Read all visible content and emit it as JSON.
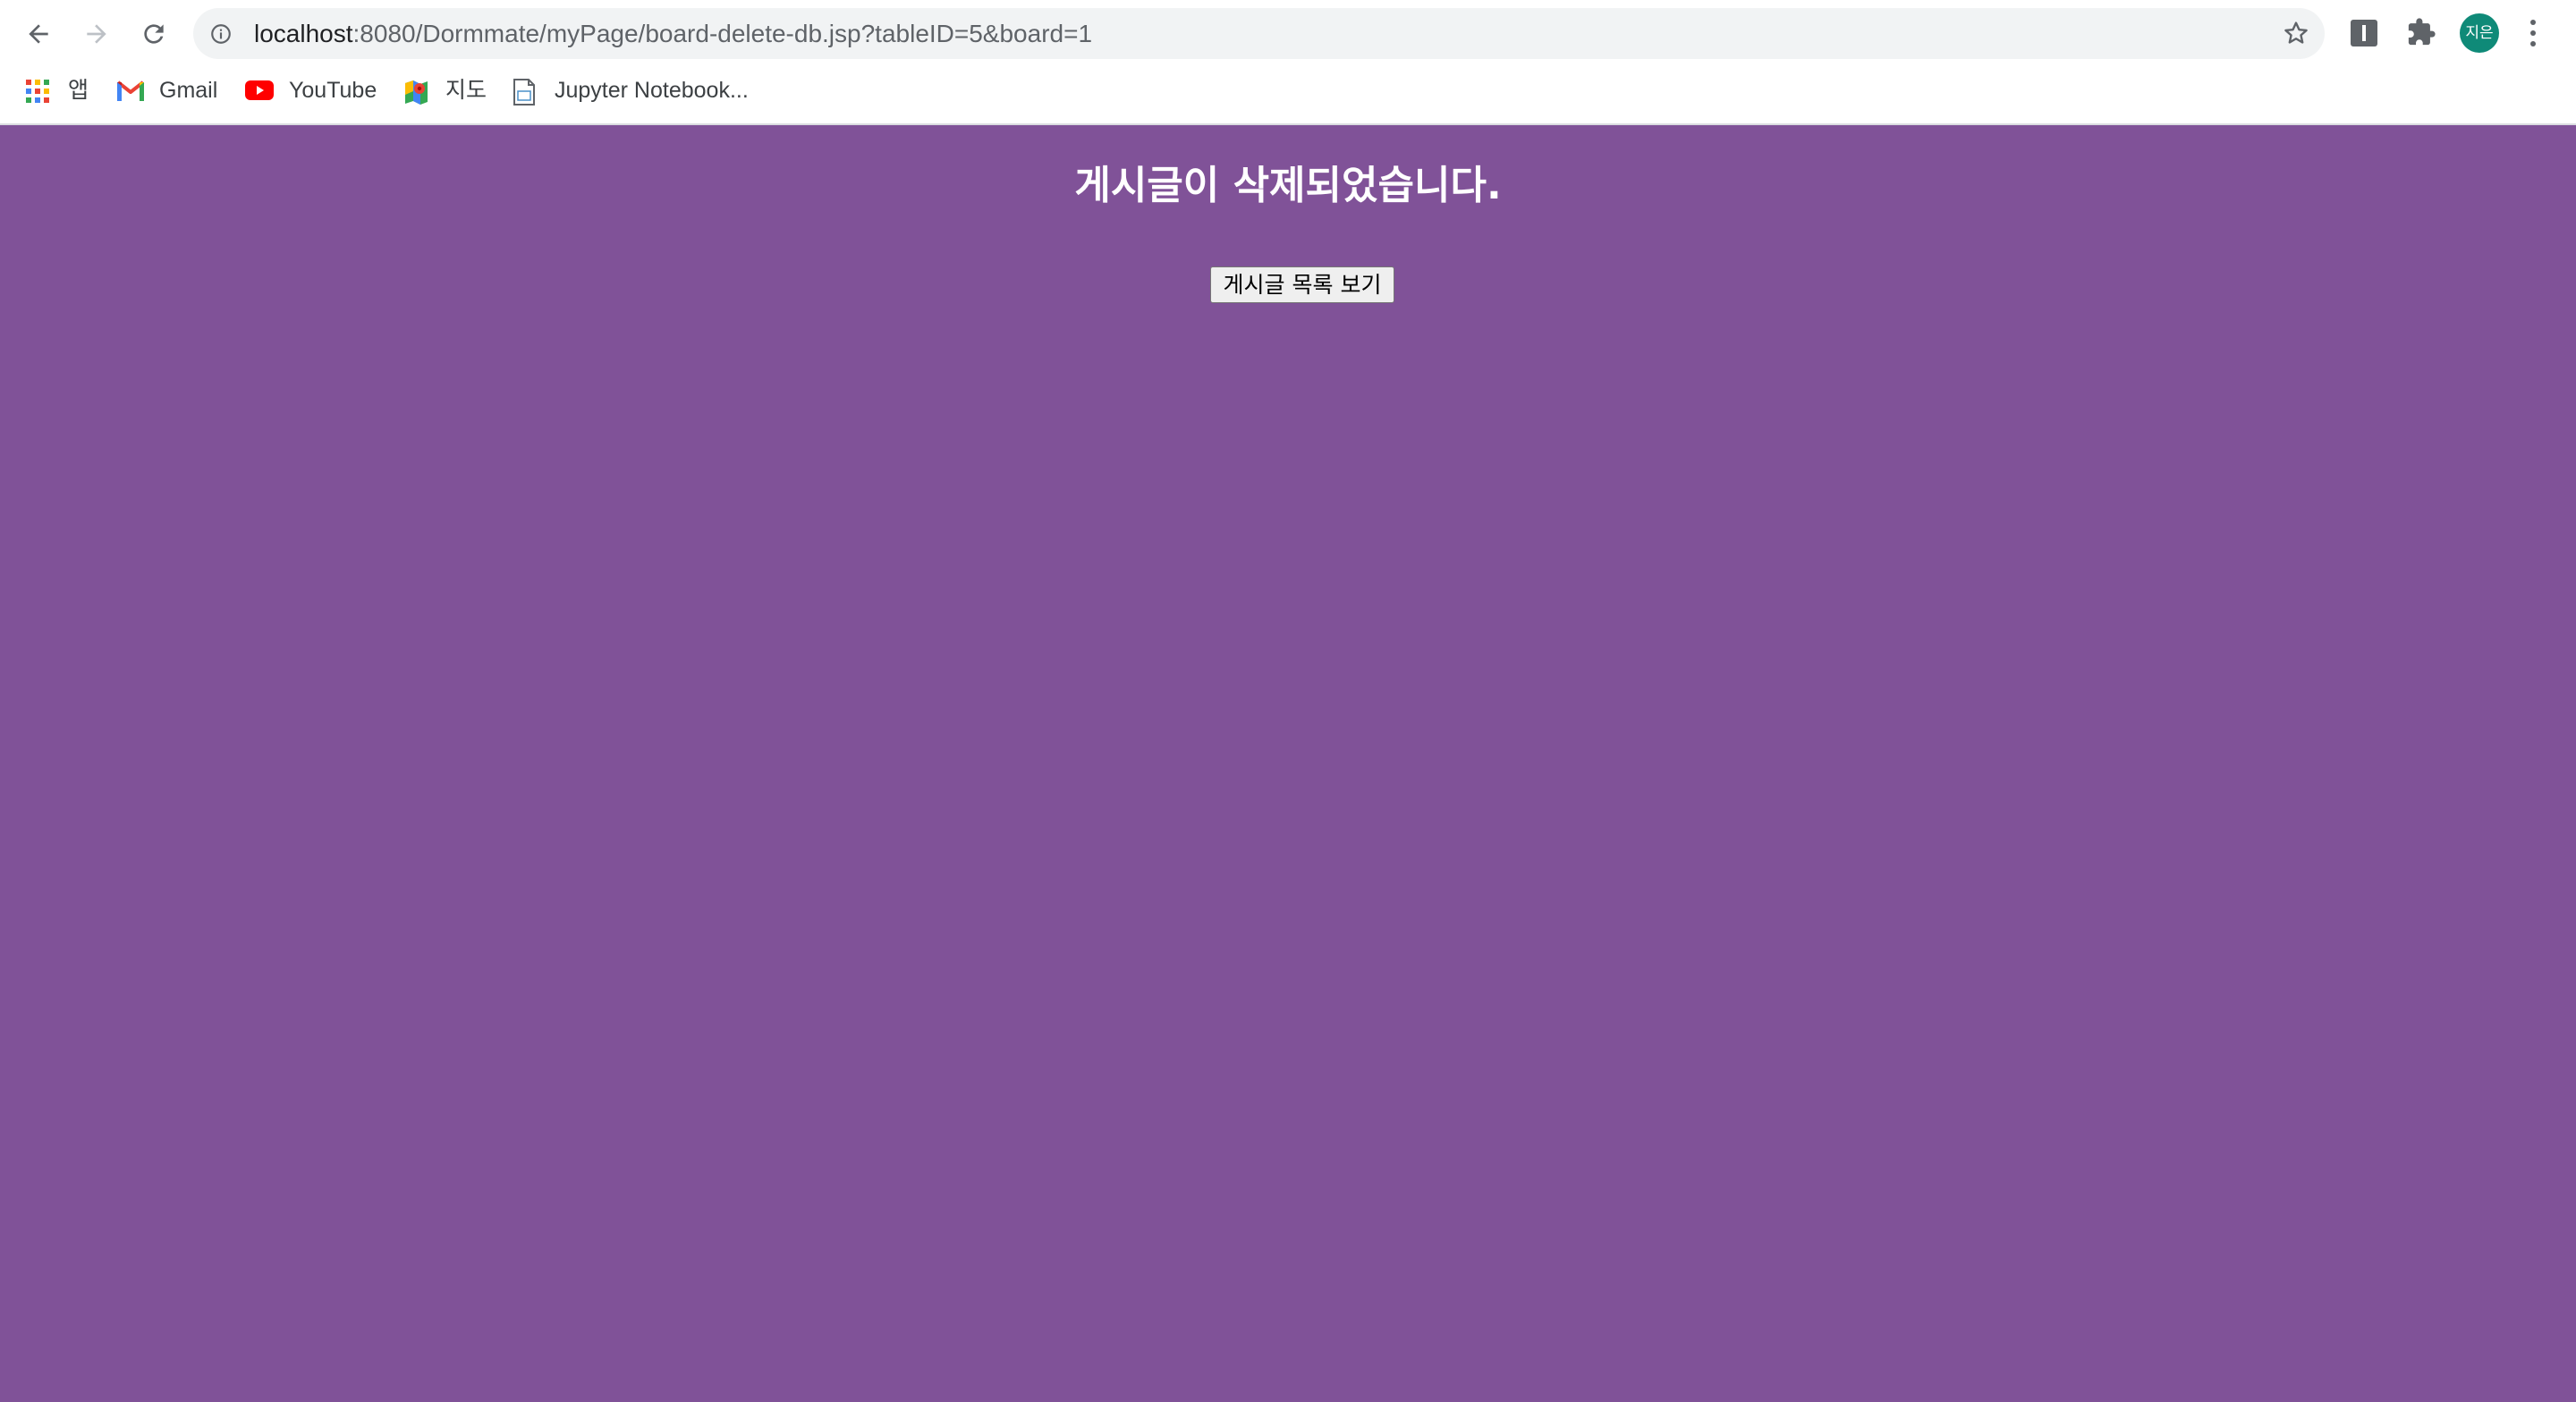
{
  "browser": {
    "url_host": "localhost",
    "url_path": ":8080/Dormmate/myPage/board-delete-db.jsp?tableID=5&board=1",
    "profile_initials": "지은"
  },
  "bookmarks": [
    {
      "label": "앱",
      "icon": "apps-grid-icon"
    },
    {
      "label": "Gmail",
      "icon": "gmail-icon"
    },
    {
      "label": "YouTube",
      "icon": "youtube-icon"
    },
    {
      "label": "지도",
      "icon": "maps-icon"
    },
    {
      "label": "Jupyter Notebook...",
      "icon": "notebook-icon"
    }
  ],
  "page": {
    "message": "게시글이 삭제되었습니다.",
    "list_button_label": "게시글 목록 보기",
    "background_color": "#805298"
  }
}
